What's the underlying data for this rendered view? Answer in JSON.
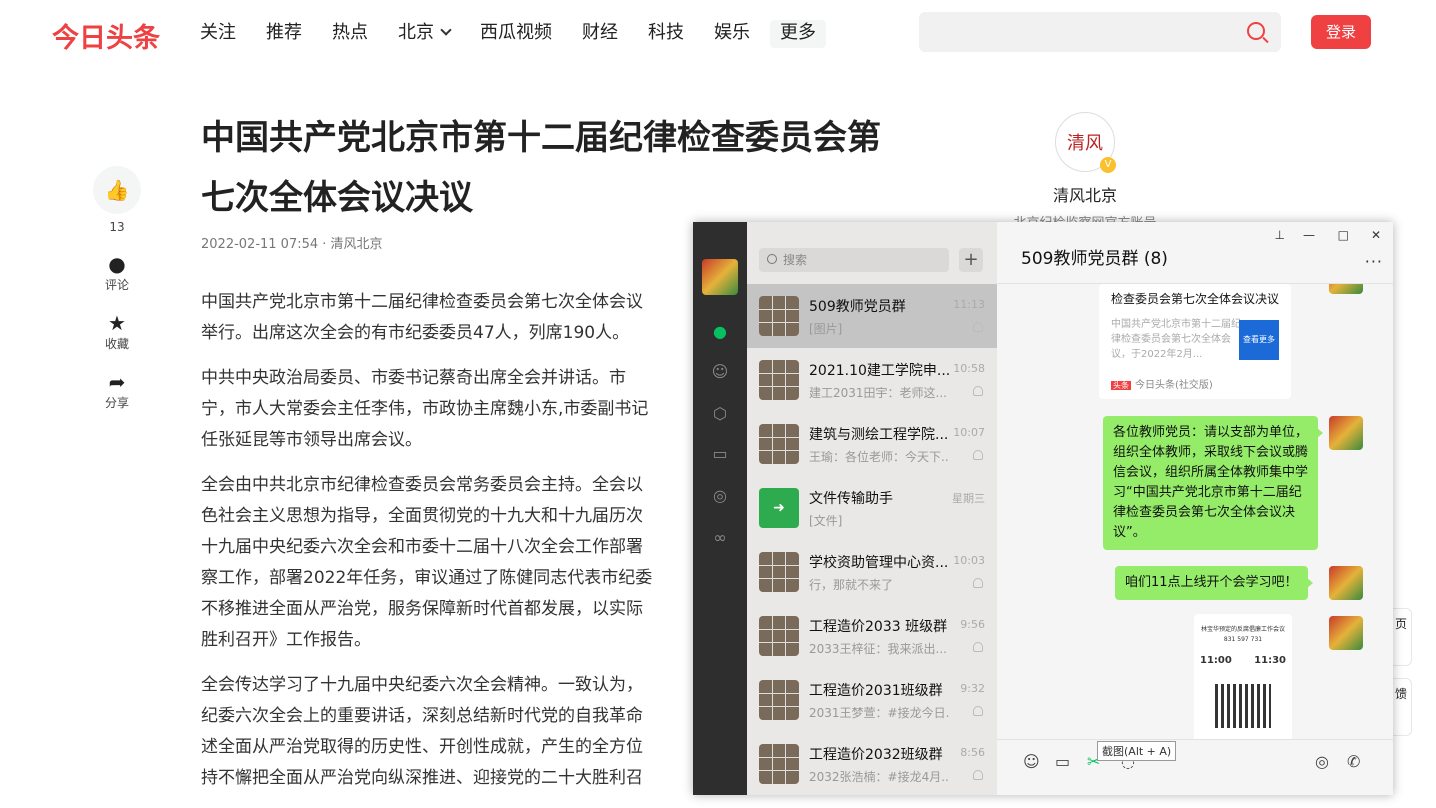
{
  "header": {
    "logo": "今日头条",
    "nav": [
      "关注",
      "推荐",
      "热点",
      "北京",
      "西瓜视频",
      "财经",
      "科技",
      "娱乐"
    ],
    "more": "更多",
    "login": "登录"
  },
  "sidebar": {
    "like_count": "13",
    "comment": "评论",
    "favorite": "收藏",
    "share": "分享"
  },
  "article": {
    "title": "中国共产党北京市第十二届纪律检查委员会第七次全体会议决议",
    "meta": "2022-02-11 07:54 · 清风北京",
    "paragraphs": [
      [
        "中国共产党北京市第十二届纪律检查委员会第七次全体会议",
        "举行。出席这次全会的有市纪委委员47人，列席190人。"
      ],
      [
        "中共中央政治局委员、市委书记蔡奇出席全会并讲话。市",
        "宁，市人大常委会主任李伟，市政协主席魏小东,市委副书记",
        "任张延昆等市领导出席会议。"
      ],
      [
        "全会由中共北京市纪律检查委员会常务委员会主持。全会以",
        "色社会主义思想为指导，全面贯彻党的十九大和十九届历次",
        "十九届中央纪委六次全会和市委十二届十八次全会工作部署",
        "察工作，部署2022年任务，审议通过了陈健同志代表市纪委",
        "不移推进全面从严治党，服务保障新时代首都发展，以实际",
        "胜利召开》工作报告。"
      ],
      [
        "全会传达学习了十九届中央纪委六次全会精神。一致认为，",
        "纪委六次全会上的重要讲话，深刻总结新时代党的自我革命",
        "述全面从严治党取得的历史性、开创性成就，产生的全方位",
        "持不懈把全面从严治党向纵深推进、迎接党的二十大胜利召"
      ]
    ]
  },
  "author": {
    "avatar_text": "清风",
    "name": "清风北京",
    "desc": "北京纪检监察网官方账号"
  },
  "right_tools": [
    "页",
    "馈"
  ],
  "wechat": {
    "search_placeholder": "搜索",
    "chats": [
      {
        "name": "509教师党员群",
        "preview": "[图片]",
        "time": "11:13"
      },
      {
        "name": "2021.10建工学院申...",
        "preview": "建工2031田宇：老师这...",
        "time": "10:58"
      },
      {
        "name": "建筑与测绘工程学院...",
        "preview": "王瑜：各位老师：今天下...",
        "time": "10:07"
      },
      {
        "name": "文件传输助手",
        "preview": "[文件]",
        "time": "星期三"
      },
      {
        "name": "学校资助管理中心资...",
        "preview": "行，那就不来了",
        "time": "10:03"
      },
      {
        "name": "工程造价2033 班级群",
        "preview": "2033王梓征：我来派出...",
        "time": "9:56"
      },
      {
        "name": "工程造价2031班级群",
        "preview": "2031王梦萱：#接龙今日...",
        "time": "9:32"
      },
      {
        "name": "工程造价2032班级群",
        "preview": "2032张浩楠：#接龙4月...",
        "time": "8:56"
      }
    ],
    "title": "509教师党员群 (8)",
    "card": {
      "title": "检查委员会第七次全体会议决议",
      "desc": "中国共产党北京市第十二届纪律检查委员会第七次全体会议，于2022年2月...",
      "img_text": "查看更多",
      "source": "今日头条(社交版)"
    },
    "msg1": "各位教师党员：请以支部为单位，组织全体教师，采取线下会议或腾信会议，组织所属全体教师集中学习“中国共产党北京市第十二届纪律检查委员会第七次全体会议决议”。",
    "msg2": "咱们11点上线开个会学习吧！",
    "img_msg": {
      "title": "林宝华预定的反腐倡廉工作会议",
      "id": "831 597 731",
      "start": "11:00",
      "end": "11:30"
    },
    "tooltip": "截图(Alt + A)"
  }
}
